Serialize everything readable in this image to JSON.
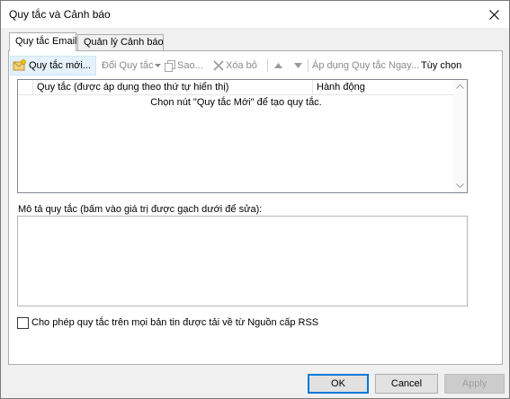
{
  "window": {
    "title": "Quy tắc và Cảnh báo"
  },
  "tabs": [
    {
      "label": "Quy tắc Email",
      "active": true
    },
    {
      "label": "Quản lý Cảnh báo",
      "active": false
    }
  ],
  "toolbar": {
    "new_rule": "Quy tắc mới...",
    "change_rule": "Đổi Quy tắc",
    "copy": "Sao...",
    "delete": "Xóa bỏ",
    "apply_rules": "Áp dụng Quy tắc Ngay...",
    "options": "Tùy chọn"
  },
  "rules_list": {
    "columns": [
      "Quy tắc (được áp dụng theo thứ tự hiển thị)",
      "Hành động"
    ],
    "empty_message": "Chọn nút \"Quy tắc Mới\" để tạo quy tắc."
  },
  "description": {
    "label": "Mô tả quy tắc (bấm vào giá trị được gạch dưới để sửa):",
    "value": ""
  },
  "rss": {
    "label": "Cho phép quy tắc trên mọi bản tin được tải về từ Nguồn cấp RSS",
    "checked": false
  },
  "buttons": {
    "ok": "OK",
    "cancel": "Cancel",
    "apply": "Apply"
  },
  "colors": {
    "accent": "#0078d7",
    "hover": "#e5f1fb",
    "disabled_text": "#8a8a8a"
  }
}
